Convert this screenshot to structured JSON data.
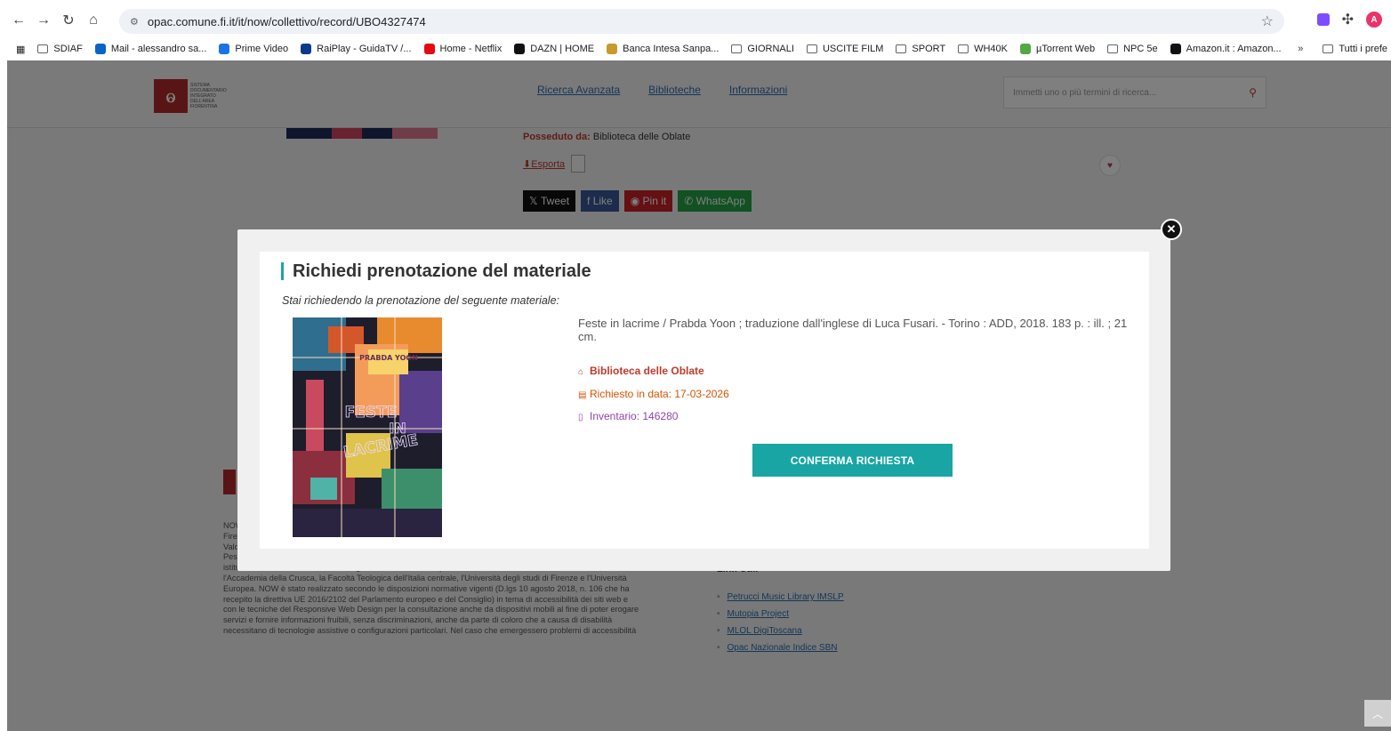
{
  "browser": {
    "url": "opac.comune.fi.it/it/now/collettivo/record/UBO4327474",
    "bookmarks": [
      {
        "label": "SDIAF",
        "icon": "folder-icon",
        "color": ""
      },
      {
        "label": "Mail - alessandro sa...",
        "icon": "outlook-icon",
        "color": "#0a64c8"
      },
      {
        "label": "Prime Video",
        "icon": "prime-video-icon",
        "color": "#1a73e8"
      },
      {
        "label": "RaiPlay - GuidaTV /...",
        "icon": "rai-icon",
        "color": "#0b3a8c"
      },
      {
        "label": "Home - Netflix",
        "icon": "netflix-icon",
        "color": "#e50914"
      },
      {
        "label": "DAZN | HOME",
        "icon": "dazn-icon",
        "color": "#111111"
      },
      {
        "label": "Banca Intesa Sanpa...",
        "icon": "intesa-icon",
        "color": "#c89a2b"
      },
      {
        "label": "GIORNALI",
        "icon": "folder-icon",
        "color": ""
      },
      {
        "label": "USCITE FILM",
        "icon": "folder-icon",
        "color": ""
      },
      {
        "label": "SPORT",
        "icon": "folder-icon",
        "color": ""
      },
      {
        "label": "WH40K",
        "icon": "folder-icon",
        "color": ""
      },
      {
        "label": "µTorrent Web",
        "icon": "utorrent-icon",
        "color": "#53a845"
      },
      {
        "label": "NPC 5e",
        "icon": "folder-icon",
        "color": ""
      },
      {
        "label": "Amazon.it : Amazon...",
        "icon": "amazon-icon",
        "color": "#111111"
      }
    ],
    "bookmarks_more": "»",
    "all_bookmarks": "Tutti i prefe",
    "profile_initial": "A"
  },
  "site": {
    "nav": [
      "Ricerca Avanzata",
      "Biblioteche",
      "Informazioni"
    ],
    "search_placeholder": "Immetti uno o più termini di ricerca...",
    "owned_by_label": "Posseduto da:",
    "owned_by_value": "Biblioteca delle Oblate",
    "export": "Esporta",
    "social": [
      "Tweet",
      "Like",
      "Pin it",
      "WhatsApp"
    ],
    "footer_text": "NOW ... Promuovono il Sistema Documentario Integrato dell'Area Fiorentina SDIAF la Città metropolitana di Firenze e i Comuni di: Bagno a Ripoli, Barberino Tavarnelle, Calenzano, Campi Bisenzio, Fiesole, Figline e Incisa Valdarno, Firenze, Greve in Chianti, Impruneta, Lastra a Signa, Reggello, Rignano sull'Arno, San Casciano Val di Pesa, Scandicci, Sesto Fiorentino, Signa, Vaglia Il Sistema è stato ampliato, con apposite convenzioni, a decine di istituti culturali, Associazioni, Enti religiosi e Università. Tra questi ricordiamo il Gabinetto G.P. Vieusseux, l'Accademia della Crusca, la Facoltà Teologica dell'Italia centrale, l'Università degli studi di Firenze e l'Università Europea. NOW è stato realizzato secondo le disposizioni normative vigenti (D.lgs 10 agosto 2018, n. 106 che ha recepito la direttiva UE 2016/2102 del Parlamento europeo e del Consiglio) in tema di accessibilità dei siti web e con le tecniche del Responsive Web Design per la consultazione anche da dispositivi mobili al fine di poter erogare servizi e fornire informazioni fruibili, senza discriminazioni, anche da parte di coloro che a causa di disabilità necessitano di tecnologie assistive o configurazioni particolari. Nel caso che emergessero problemi di accessibilità",
    "footer_links_title": "Link Utili",
    "footer_links": [
      "Petrucci Music Library IMSLP",
      "Mutopia Project",
      "MLOL DigiToscana",
      "Opac Nazionale Indice SBN"
    ]
  },
  "modal": {
    "title": "Richiedi prenotazione del materiale",
    "subtitle": "Stai richiedendo la prenotazione del seguente materiale:",
    "description": "Feste in lacrime / Prabda Yoon ; traduzione dall'inglese di Luca Fusari. - Torino : ADD, 2018. 183 p. : ill. ; 21 cm.",
    "library": "Biblioteca delle Oblate",
    "requested_date": "Richiesto in data: 17-03-2026",
    "inventory": "Inventario: 146280",
    "confirm_label": "CONFERMA RICHIESTA",
    "cover": {
      "author": "PRABDA YOON",
      "title_line1": "FESTE",
      "title_line2": "IN",
      "title_line3": "LACRIME"
    }
  },
  "colors": {
    "accent": "#1aa5a5",
    "library": "#c0392b",
    "date": "#d35400",
    "inventory": "#8e44ad"
  }
}
